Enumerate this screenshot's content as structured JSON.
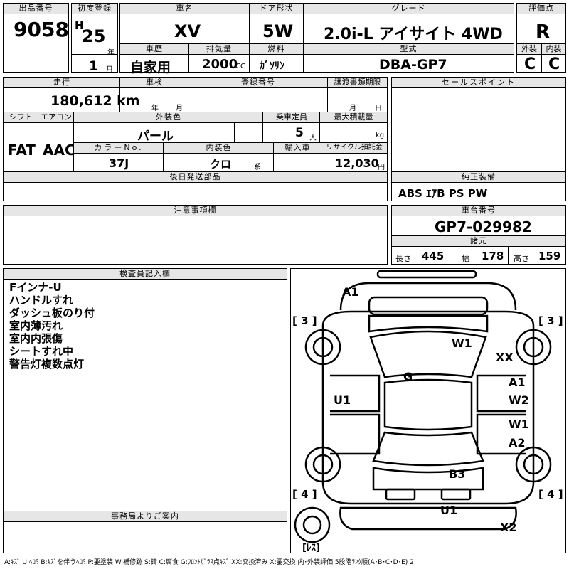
{
  "top": {
    "lot_no_label": "出品番号",
    "lot_no": "9058",
    "first_reg_label": "初度登録",
    "era": "H",
    "year": "25",
    "year_unit": "年",
    "month": "1",
    "month_unit": "月",
    "car_name_label": "車名",
    "car_name": "XV",
    "door_label": "ドア形状",
    "door": "5W",
    "grade_label": "グレード",
    "grade": "2.0i-L アイサイト 4WD",
    "score_label": "評価点",
    "score": "R",
    "history_label": "車歴",
    "history": "自家用",
    "displacement_label": "排気量",
    "displacement": "2000",
    "displacement_unit": "CC",
    "fuel_label": "燃料",
    "fuel": "ｶﾞｿﾘﾝ",
    "model_label": "型式",
    "model": "DBA-GP7",
    "exterior_label": "外装",
    "exterior": "C",
    "interior_label": "内装",
    "interior": "C"
  },
  "mid": {
    "mileage_label": "走行",
    "mileage": "180,612 km",
    "inspection_label": "車検",
    "year_unit": "年",
    "month_unit": "月",
    "day_unit": "日",
    "reg_no_label": "登録番号",
    "transfer_label": "譲渡書類期限",
    "shift_label": "シフト",
    "shift": "FAT",
    "aircon_label": "エアコン",
    "aircon": "AAC",
    "ext_color_label": "外装色",
    "ext_color": "パール",
    "capacity_label": "乗車定員",
    "capacity": "5",
    "capacity_unit": "人",
    "load_label": "最大積載量",
    "load_unit": "kg",
    "color_no_label": "カラーNo.",
    "color_no": "37J",
    "int_color_label": "内装色",
    "int_color": "クロ",
    "int_color_unit": "系",
    "import_label": "輸入車",
    "recycle_label": "リサイクル預託金",
    "recycle": "12,030",
    "recycle_unit": "円",
    "later_parts_label": "後日発送部品"
  },
  "right": {
    "sales_point_label": "セールスポイント",
    "equipment_label": "純正装備",
    "equipment": "ABS ｴｱB PS PW",
    "chassis_label": "車台番号",
    "chassis": "GP7-029982",
    "spec_label": "諸元",
    "length_label": "長さ",
    "length": "445",
    "width_label": "幅",
    "width": "178",
    "height_label": "高さ",
    "height": "159"
  },
  "notes": {
    "label": "注意事項欄"
  },
  "inspector": {
    "label": "検査員記入欄",
    "remarks": [
      "Fインナ-U",
      "ハンドルすれ",
      "ダッシュ板のり付",
      "室内薄汚れ",
      "室内内張傷",
      "シートすれ中",
      "警告灯複数点灯"
    ]
  },
  "office": {
    "label": "事務局よりご案内"
  },
  "diagram": {
    "marks": {
      "a1_front": "A1",
      "w1_roof": "W1",
      "xx_side": "XX",
      "g_glass": "G",
      "u1_left": "U1",
      "a1_right": "A1",
      "w2_right": "W2",
      "w1_right": "W1",
      "a2_right": "A2",
      "b3_rear": "B3",
      "u1_rear": "U1",
      "x2_rear": "X2"
    },
    "tire_fl": "[ 3 ]",
    "tire_fr": "[ 3 ]",
    "tire_rl": "[ 4 ]",
    "tire_rr": "[ 4 ]",
    "spare": "[ﾚｽ]"
  },
  "legend": "A:ｷｽﾞ U:ﾍｺﾐ B:ｷｽﾞを伴うﾍｺﾐ P:要塗装 W:補修跡 S:錆 C:腐食 G:ﾌﾛﾝﾄｶﾞﾗｽ点ｷｽﾞ XX:交換済み X:要交換 内･外装評価 5段階ﾗﾝｸ順(A･B･C･D･E) 2"
}
